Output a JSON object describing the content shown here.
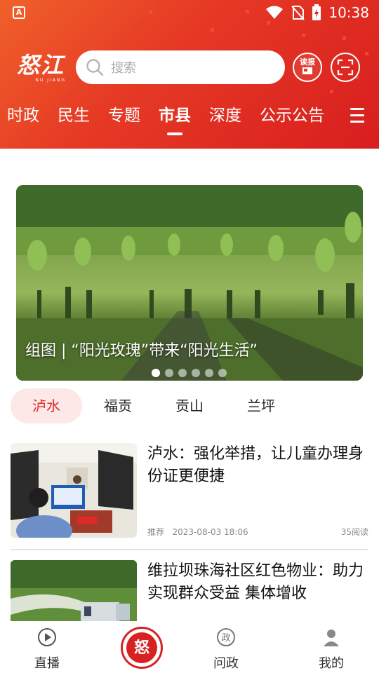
{
  "status_bar": {
    "time": "10:38",
    "app_indicator": "A"
  },
  "header": {
    "logo_text": "怒江",
    "logo_subtext": "NU JIANG",
    "search_placeholder": "搜索",
    "read_button_label": "读报",
    "icons": {
      "search": "search-icon",
      "scan": "scan-icon"
    }
  },
  "nav": {
    "tabs": [
      {
        "label": "时政",
        "active": false
      },
      {
        "label": "民生",
        "active": false
      },
      {
        "label": "专题",
        "active": false
      },
      {
        "label": "市县",
        "active": true
      },
      {
        "label": "深度",
        "active": false
      },
      {
        "label": "公示公告",
        "active": false
      }
    ],
    "menu_icon": "menu-icon"
  },
  "banner": {
    "caption": "组图 | “阳光玫瑰”带来“阳光生活”",
    "slide_count": 6,
    "active_slide": 1
  },
  "county_tabs": [
    {
      "label": "泸水",
      "active": true
    },
    {
      "label": "福贡",
      "active": false
    },
    {
      "label": "贡山",
      "active": false
    },
    {
      "label": "兰坪",
      "active": false
    }
  ],
  "articles": [
    {
      "title": "泸水：强化举措，让儿童办理身份证更便捷",
      "tag": "推荐",
      "datetime": "2023-08-03 18:06",
      "reads": "35阅读"
    },
    {
      "title": "维拉坝珠海社区红色物业：助力实现群众受益 集体增收",
      "tag": "",
      "datetime": "",
      "reads": ""
    }
  ],
  "tabbar": {
    "items": [
      {
        "label": "直播",
        "icon": "play-icon"
      },
      {
        "label": "",
        "icon": "home-logo-icon"
      },
      {
        "label": "问政",
        "icon": "zheng-icon"
      },
      {
        "label": "我的",
        "icon": "profile-icon"
      }
    ],
    "center_logo_text": "怒"
  },
  "colors": {
    "brand_red": "#d81e1e",
    "active_tab_bg": "#fde8e8",
    "active_tab_text": "#e0262a"
  }
}
